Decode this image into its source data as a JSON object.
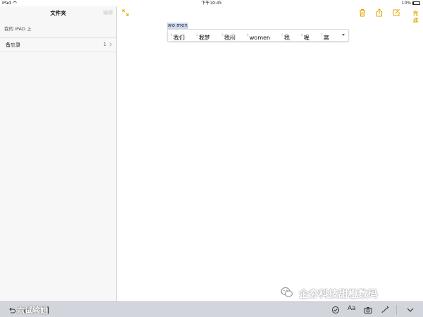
{
  "status_bar": {
    "device": "iPad",
    "time": "下午10:45",
    "battery": "10%"
  },
  "sidebar": {
    "title": "文件夹",
    "edit_label": "编辑",
    "section_label": "我的 IPAD 上",
    "folders": [
      {
        "name": "备忘录",
        "count": "1"
      }
    ]
  },
  "toolbar": {
    "done_label": "完成"
  },
  "editor": {
    "marked_text": "wo men",
    "candidates": [
      {
        "index": "1",
        "word": "我们"
      },
      {
        "index": "2",
        "word": "我梦"
      },
      {
        "index": "3",
        "word": "我闷"
      },
      {
        "index": "4",
        "word": "women"
      },
      {
        "index": "5",
        "word": "我"
      },
      {
        "index": "6",
        "word": "喔"
      },
      {
        "index": "7",
        "word": "窝"
      }
    ]
  },
  "bottom_bar": {
    "caption": "六试验姐",
    "format_label": "Aa"
  },
  "watermark": {
    "text": "企夯科技甜橙数码"
  },
  "colors": {
    "accent": "#e7a300",
    "sidebar_bg": "#f7f7f7",
    "keyboard_bar_bg": "#d2d5db",
    "marked_text_bg": "#cdd9ee"
  },
  "icons": [
    "wifi-icon",
    "battery-icon",
    "chevron-right-icon",
    "expand-icon",
    "trash-icon",
    "share-icon",
    "compose-icon",
    "undo-icon",
    "redo-icon",
    "paste-icon",
    "checklist-icon",
    "camera-icon",
    "sketch-icon",
    "keyboard-hide-icon",
    "wechat-logo-icon"
  ]
}
